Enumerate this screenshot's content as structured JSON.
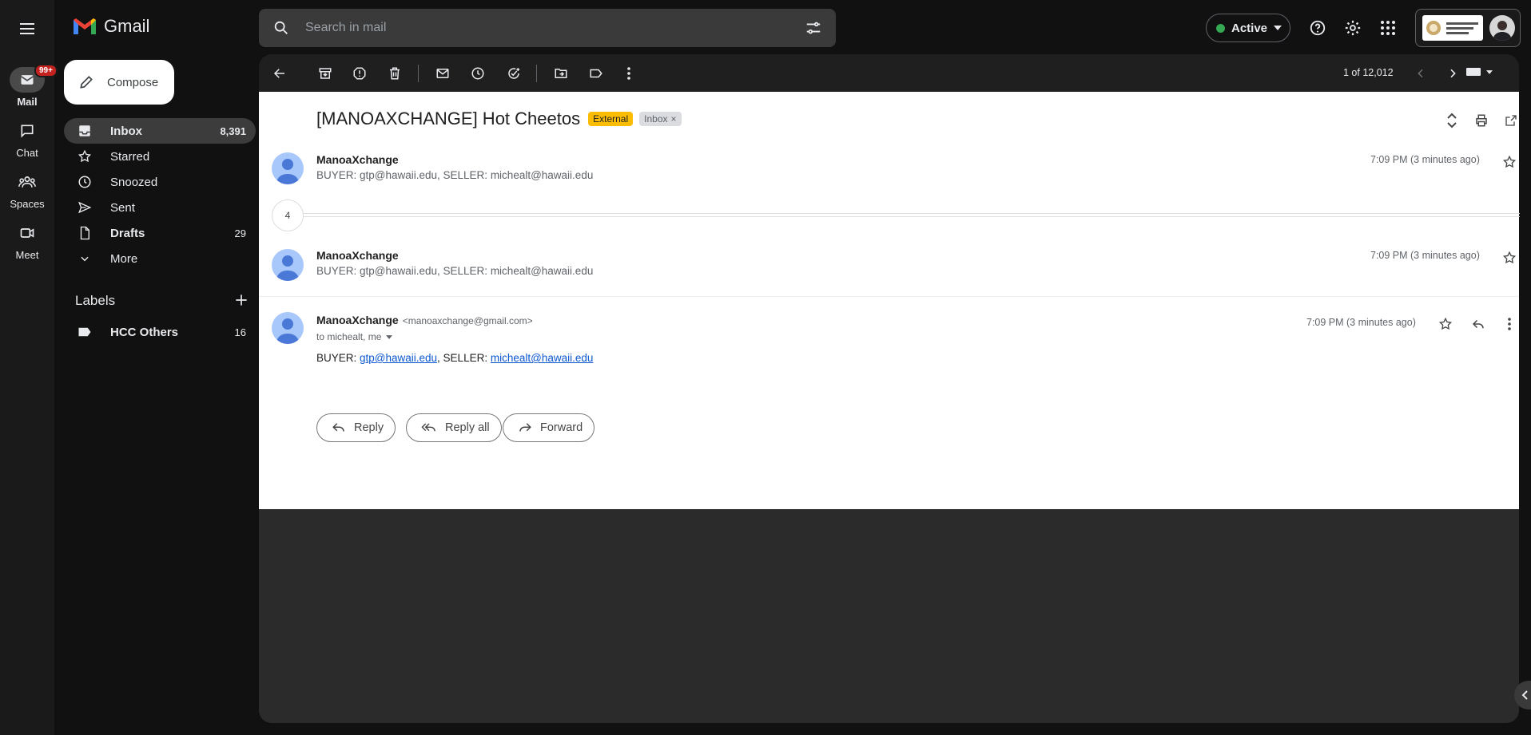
{
  "app": {
    "name": "Gmail"
  },
  "rail": {
    "mail": {
      "label": "Mail",
      "badge": "99+"
    },
    "chat": {
      "label": "Chat"
    },
    "spaces": {
      "label": "Spaces"
    },
    "meet": {
      "label": "Meet"
    }
  },
  "search": {
    "placeholder": "Search in mail"
  },
  "status": {
    "label": "Active"
  },
  "compose": {
    "label": "Compose"
  },
  "nav": [
    {
      "label": "Inbox",
      "count": "8,391"
    },
    {
      "label": "Starred",
      "count": ""
    },
    {
      "label": "Snoozed",
      "count": ""
    },
    {
      "label": "Sent",
      "count": ""
    },
    {
      "label": "Drafts",
      "count": "29"
    },
    {
      "label": "More",
      "count": ""
    }
  ],
  "labels": {
    "title": "Labels",
    "items": [
      {
        "label": "HCC Others",
        "count": "16"
      }
    ]
  },
  "toolbar": {
    "pagination": "1 of 12,012"
  },
  "thread": {
    "subject": "[MANOAXCHANGE] Hot Cheetos",
    "chip_external": "External",
    "chip_inbox": "Inbox",
    "collapsed_count": "4",
    "messages": [
      {
        "sender": "ManoaXchange",
        "snippet": "BUYER: gtp@hawaii.edu, SELLER: michealt@hawaii.edu",
        "time": "7:09 PM (3 minutes ago)"
      },
      {
        "sender": "ManoaXchange",
        "snippet": "BUYER: gtp@hawaii.edu, SELLER: michealt@hawaii.edu",
        "time": "7:09 PM (3 minutes ago)"
      }
    ],
    "expanded": {
      "sender": "ManoaXchange",
      "email": "<manoaxchange@gmail.com>",
      "to": "to michealt, me",
      "time": "7:09 PM (3 minutes ago)",
      "body_buyer_prefix": "BUYER: ",
      "buyer": "gtp@hawaii.edu",
      "body_seller_prefix": ", SELLER: ",
      "seller": "michealt@hawaii.edu"
    },
    "actions": {
      "reply": "Reply",
      "reply_all": "Reply all",
      "forward": "Forward"
    }
  },
  "colors": {
    "accent_external": "#fbbc04",
    "chip_inbox_bg": "#dadce0",
    "status_dot": "#34a853"
  }
}
